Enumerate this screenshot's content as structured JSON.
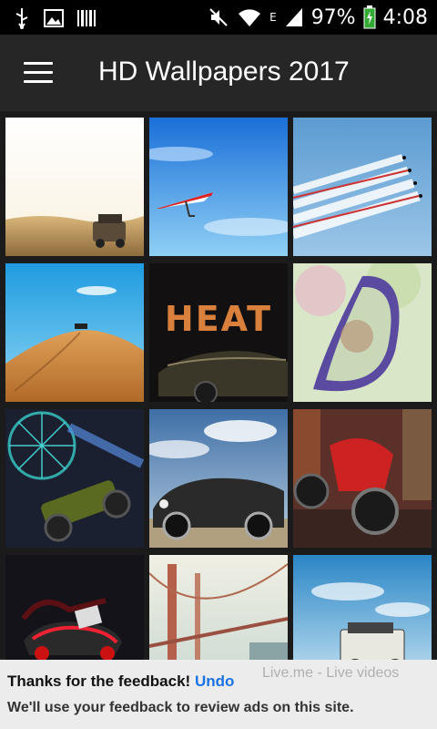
{
  "status_bar": {
    "icons": [
      "usb-icon",
      "image-icon",
      "barcode-icon",
      "mute-icon",
      "wifi-icon",
      "signal-icon",
      "battery-icon"
    ],
    "network": "E",
    "battery": "97%",
    "time": "4:08"
  },
  "app_bar": {
    "menu_icon": "hamburger-menu-icon",
    "title": "HD Wallpapers 2017"
  },
  "wallpapers": [
    {
      "subject": "desert-car"
    },
    {
      "subject": "hang-glider"
    },
    {
      "subject": "jet-formation"
    },
    {
      "subject": "desert-dune"
    },
    {
      "subject": "heat-car"
    },
    {
      "subject": "side-mirror"
    },
    {
      "subject": "ferris-wheel-rc-car"
    },
    {
      "subject": "classic-convertible"
    },
    {
      "subject": "red-motorcycle"
    },
    {
      "subject": "red-sports-car"
    },
    {
      "subject": "golden-gate-bridge"
    },
    {
      "subject": "offroad-jeep"
    }
  ],
  "heat_text": "HEAT",
  "snackbar": {
    "message": "Thanks for the feedback!",
    "undo": "Undo",
    "detail": "We'll use your feedback to review ads on this site.",
    "ghost_ad_text": "Live.me - Live videos"
  }
}
